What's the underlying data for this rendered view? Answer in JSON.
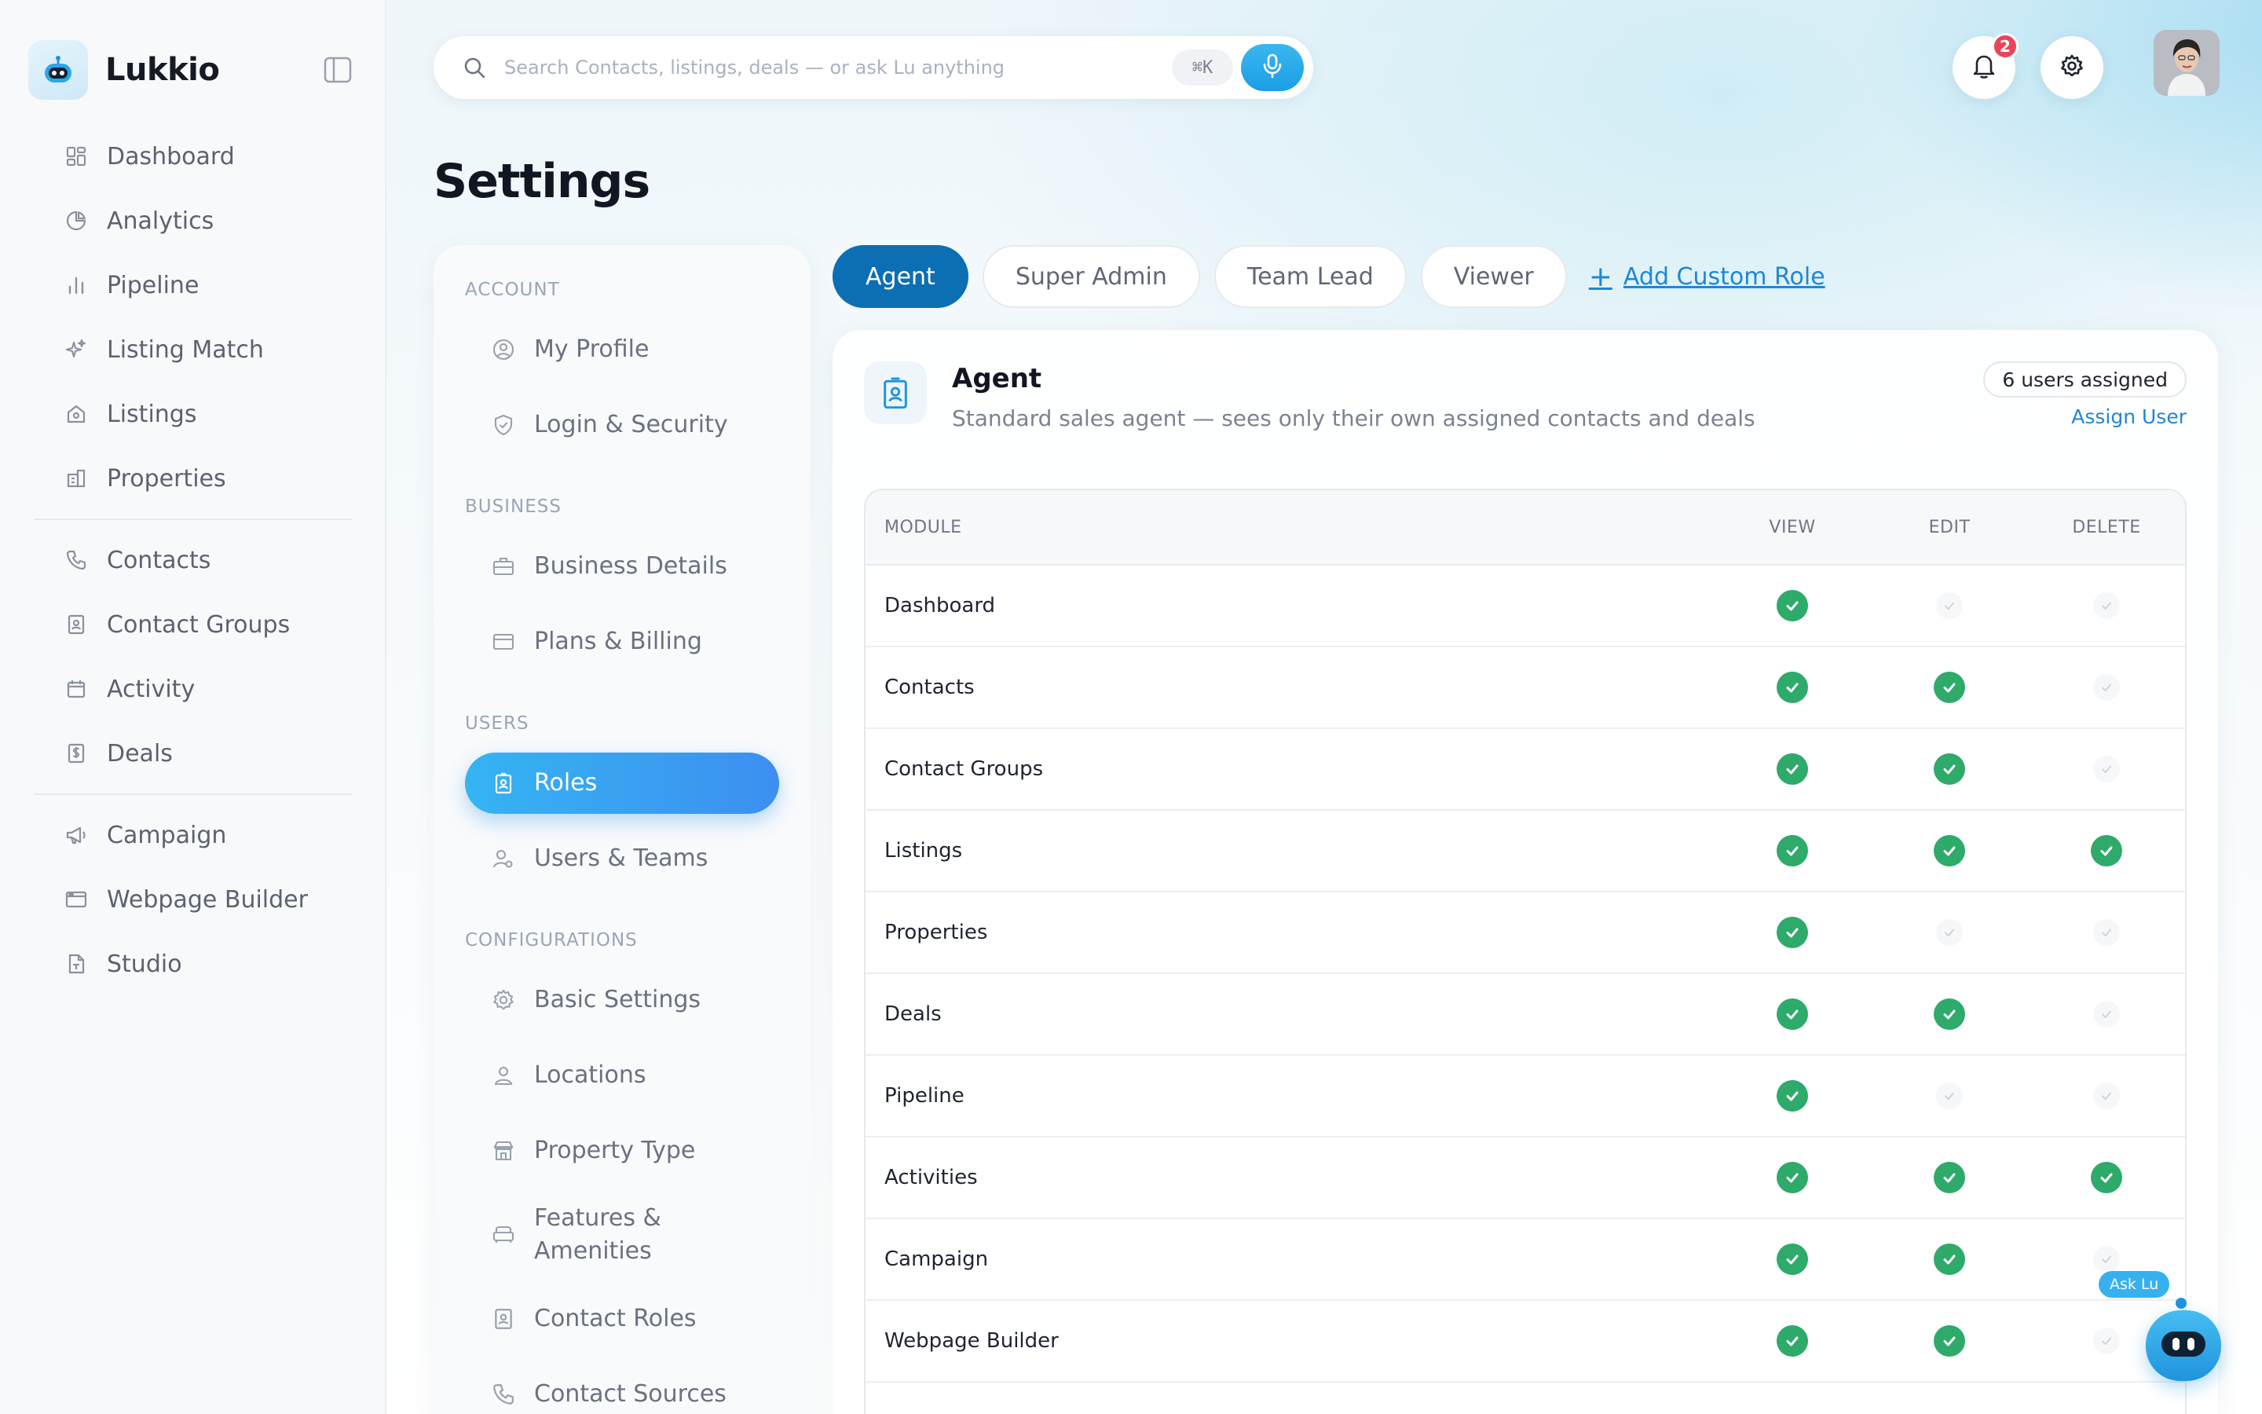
{
  "app": {
    "name": "Lukkio",
    "logo_icon": "robot-logo-icon"
  },
  "sidebar": {
    "groups": [
      [
        {
          "label": "Dashboard",
          "icon": "grid-icon"
        },
        {
          "label": "Analytics",
          "icon": "pie-chart-icon"
        },
        {
          "label": "Pipeline",
          "icon": "bar-chart-icon"
        },
        {
          "label": "Listing Match",
          "icon": "sparkles-icon"
        },
        {
          "label": "Listings",
          "icon": "house-icon"
        },
        {
          "label": "Properties",
          "icon": "building-icon"
        }
      ],
      [
        {
          "label": "Contacts",
          "icon": "phone-icon"
        },
        {
          "label": "Contact Groups",
          "icon": "contact-book-icon"
        },
        {
          "label": "Activity",
          "icon": "calendar-icon"
        },
        {
          "label": "Deals",
          "icon": "dollar-doc-icon"
        }
      ],
      [
        {
          "label": "Campaign",
          "icon": "megaphone-icon"
        },
        {
          "label": "Webpage Builder",
          "icon": "browser-icon"
        },
        {
          "label": "Studio",
          "icon": "document-icon"
        }
      ]
    ]
  },
  "search": {
    "placeholder": "Search Contacts, listings, deals — or ask Lu anything",
    "shortcut": "⌘K"
  },
  "header": {
    "notification_count": "2"
  },
  "page": {
    "title": "Settings"
  },
  "settings_menu": {
    "sections": [
      {
        "title": "ACCOUNT",
        "items": [
          {
            "label": "My Profile",
            "icon": "user-circle-icon"
          },
          {
            "label": "Login & Security",
            "icon": "shield-icon"
          }
        ]
      },
      {
        "title": "BUSINESS",
        "items": [
          {
            "label": "Business Details",
            "icon": "briefcase-icon"
          },
          {
            "label": "Plans & Billing",
            "icon": "credit-card-icon"
          }
        ]
      },
      {
        "title": "USERS",
        "items": [
          {
            "label": "Roles",
            "icon": "id-badge-icon",
            "active": true
          },
          {
            "label": "Users & Teams",
            "icon": "users-icon"
          }
        ]
      },
      {
        "title": "CONFIGURATIONS",
        "items": [
          {
            "label": "Basic Settings",
            "icon": "gear-icon"
          },
          {
            "label": "Locations",
            "icon": "location-user-icon"
          },
          {
            "label": "Property Type",
            "icon": "store-icon"
          },
          {
            "label": "Features & Amenities",
            "icon": "sofa-icon"
          },
          {
            "label": "Contact Roles",
            "icon": "contact-book-icon"
          },
          {
            "label": "Contact Sources",
            "icon": "phone-icon"
          }
        ]
      }
    ]
  },
  "roles": {
    "tabs": [
      "Agent",
      "Super Admin",
      "Team Lead",
      "Viewer"
    ],
    "active_tab": "Agent",
    "add_label": "Add Custom Role"
  },
  "role_detail": {
    "name": "Agent",
    "description": "Standard sales agent — sees only their own assigned contacts and deals",
    "users_assigned": "6 users assigned",
    "assign_label": "Assign User"
  },
  "permissions": {
    "headers": {
      "module": "MODULE",
      "view": "VIEW",
      "edit": "EDIT",
      "delete": "DELETE"
    },
    "rows": [
      {
        "module": "Dashboard",
        "view": true,
        "edit": false,
        "delete": false
      },
      {
        "module": "Contacts",
        "view": true,
        "edit": true,
        "delete": false
      },
      {
        "module": "Contact Groups",
        "view": true,
        "edit": true,
        "delete": false
      },
      {
        "module": "Listings",
        "view": true,
        "edit": true,
        "delete": true
      },
      {
        "module": "Properties",
        "view": true,
        "edit": false,
        "delete": false
      },
      {
        "module": "Deals",
        "view": true,
        "edit": true,
        "delete": false
      },
      {
        "module": "Pipeline",
        "view": true,
        "edit": false,
        "delete": false
      },
      {
        "module": "Activities",
        "view": true,
        "edit": true,
        "delete": true
      },
      {
        "module": "Campaign",
        "view": true,
        "edit": true,
        "delete": false
      },
      {
        "module": "Webpage Builder",
        "view": true,
        "edit": true,
        "delete": false
      }
    ]
  },
  "ask_lu": {
    "label": "Ask Lu"
  },
  "colors": {
    "accent": "#1f87d6",
    "active_tab": "#0c6fb4",
    "check_green": "#2eaa6a",
    "badge_red": "#e8455b"
  }
}
